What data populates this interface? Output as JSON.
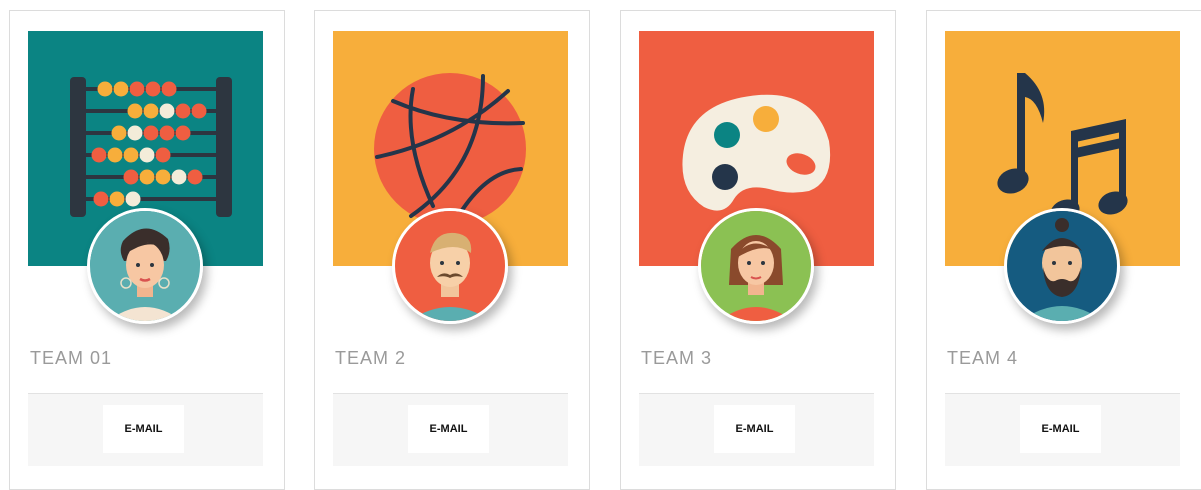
{
  "cards": [
    {
      "name": "TEAM 01",
      "email_label": "E-MAIL",
      "banner_icon": "abacus-icon",
      "banner_color": "#0b8483",
      "avatar_bg": "#5aaeb0"
    },
    {
      "name": "TEAM 2",
      "email_label": "E-MAIL",
      "banner_icon": "basketball-icon",
      "banner_color": "#f7ae3b",
      "avatar_bg": "#ef5e41"
    },
    {
      "name": "TEAM 3",
      "email_label": "E-MAIL",
      "banner_icon": "paint-palette-icon",
      "banner_color": "#ef5e41",
      "avatar_bg": "#8bc153"
    },
    {
      "name": "TEAM 4",
      "email_label": "E-MAIL",
      "banner_icon": "music-notes-icon",
      "banner_color": "#f7ae3b",
      "avatar_bg": "#155b80"
    }
  ]
}
